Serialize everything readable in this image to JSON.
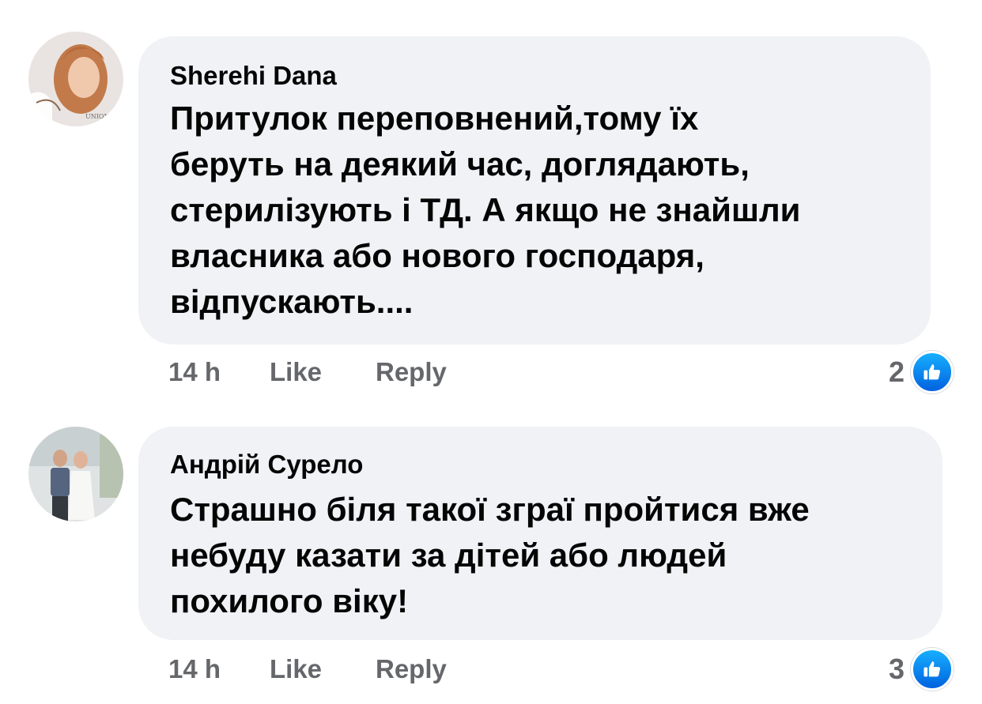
{
  "comments": [
    {
      "author": "Sherehi Dana",
      "lines": [
        "Притулок переповнений,тому їх",
        "беруть на деякий час, доглядають,",
        "стерилізують і ТД. А якщо не знайшли",
        "власника або нового господаря,",
        "відпускають...."
      ],
      "time": "14 h",
      "like_label": "Like",
      "reply_label": "Reply",
      "reaction_count": "2"
    },
    {
      "author": "Андрій Сурело",
      "lines": [
        "Страшно біля такої зграї пройтися вже",
        "небуду казати за дітей або людей",
        "похилого віку!"
      ],
      "time": "14 h",
      "like_label": "Like",
      "reply_label": "Reply",
      "reaction_count": "3"
    }
  ],
  "icons": {
    "reaction": "like-thumbs-up-icon"
  },
  "colors": {
    "bubble": "#f0f2f5",
    "meta_text": "#65676b",
    "like_blue": "#0866ff"
  }
}
